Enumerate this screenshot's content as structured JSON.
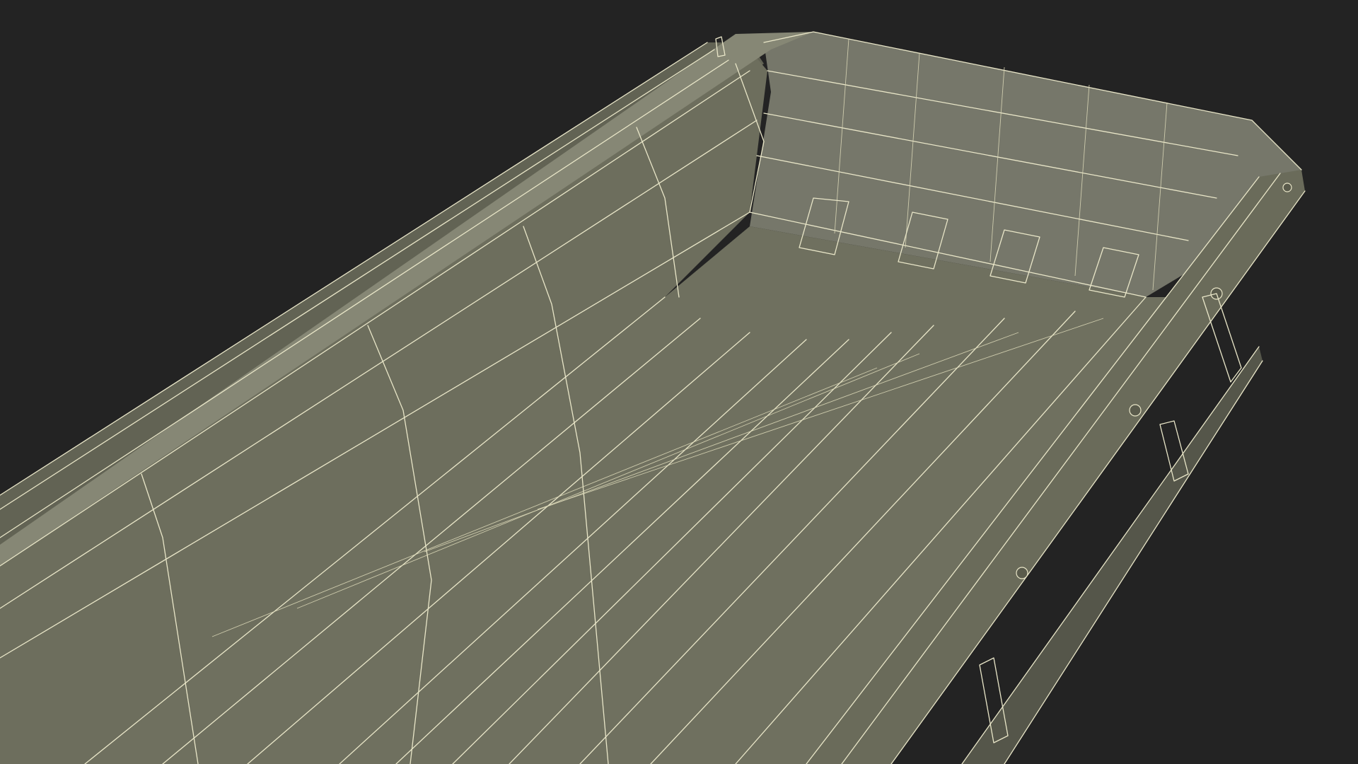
{
  "colors": {
    "background": "#232323",
    "wireframe": "#e9e6c8",
    "surface_light": "#7a7b69",
    "surface_mid": "#6a6b5a",
    "surface_dark": "#55564a",
    "floor": "#6f705f"
  }
}
